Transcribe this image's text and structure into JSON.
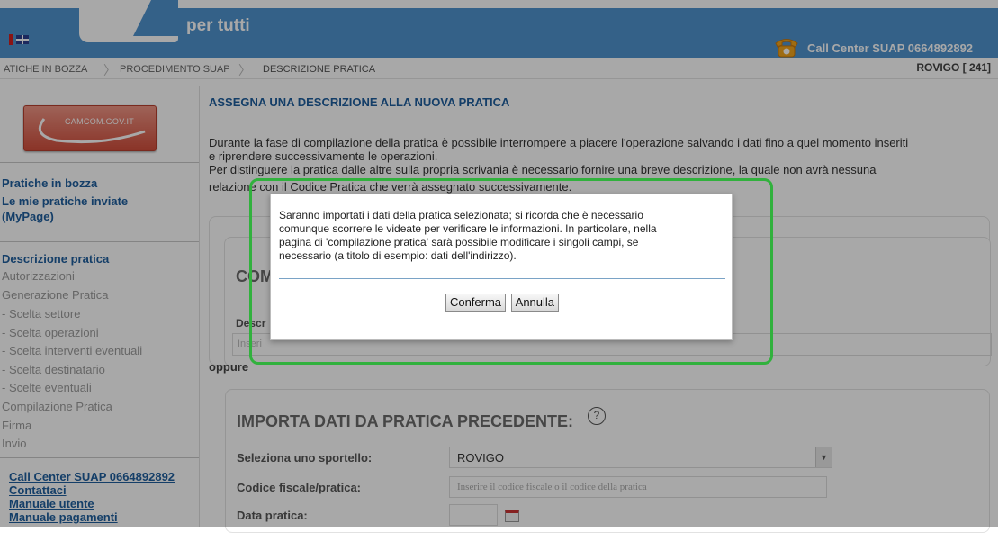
{
  "header": {
    "tagline": "per tutti",
    "call_center": "Call Center SUAP 0664892892",
    "phone_icon": "phone-icon",
    "flag_icon": "uk-flag-icon"
  },
  "breadcrumb": {
    "items": [
      "ATICHE IN BOZZA",
      "PROCEDIMENTO SUAP",
      "DESCRIZIONE PRATICA"
    ],
    "right": "ROVIGO [ 241]"
  },
  "sidebar": {
    "camcom": "CAMCOM.GOV.IT",
    "top_links": [
      "Pratiche in bozza",
      "Le mie pratiche inviate",
      "(MyPage)"
    ],
    "steps": [
      {
        "label": "Descrizione pratica",
        "active": true
      },
      {
        "label": "Autorizzazioni",
        "active": false
      },
      {
        "label": "Generazione Pratica",
        "active": false
      },
      {
        "label": "- Scelta settore",
        "active": false
      },
      {
        "label": "- Scelta operazioni",
        "active": false
      },
      {
        "label": "- Scelta interventi eventuali",
        "active": false
      },
      {
        "label": "- Scelta destinatario",
        "active": false
      },
      {
        "label": "- Scelte eventuali",
        "active": false
      },
      {
        "label": "Compilazione Pratica",
        "active": false
      },
      {
        "label": "Firma",
        "active": false
      },
      {
        "label": "Invio",
        "active": false
      }
    ],
    "bottom_links": [
      "Call Center SUAP 0664892892",
      "Contattaci",
      "Manuale utente",
      "Manuale pagamenti"
    ]
  },
  "main": {
    "title": "ASSEGNA UNA DESCRIZIONE ALLA NUOVA PRATICA",
    "para1_line1": "Durante la fase di compilazione della pratica è possibile interrompere a piacere l'operazione salvando i dati fino a quel momento inseriti",
    "para1_line2": "e riprendere successivamente le operazioni.",
    "para2_line1": "Per distinguere la pratica dalle altre sulla propria scrivania è necessario fornire una breve descrizione, la quale non avrà nessuna",
    "para2_line2": "relazione con il Codice Pratica che verrà assegnato successivamente.",
    "section1_title": "COM",
    "desc_label": "Descr",
    "desc_placeholder": "Inseri",
    "oppure": "oppure",
    "section2_title": "IMPORTA DATI DA PRATICA PRECEDENTE:",
    "help": "?",
    "sportello_label": "Seleziona uno sportello:",
    "sportello_value": "ROVIGO",
    "codice_label": "Codice fiscale/pratica:",
    "codice_placeholder": "Inserire il codice fiscale o il codice della pratica",
    "data_label": "Data pratica:"
  },
  "dialog": {
    "line1": "Saranno importati i dati della pratica selezionata; si ricorda che è necessario",
    "line2": "comunque scorrere le videate per verificare le informazioni. In particolare, nella",
    "line3": "pagina di 'compilazione pratica' sarà possibile modificare i singoli campi, se",
    "line4": "necessario (a titolo di esempio: dati dell'indirizzo).",
    "confirm": "Conferma",
    "cancel": "Annulla"
  },
  "colors": {
    "header": "#4f93cf",
    "link": "#1f5f9e",
    "highlight": "#31b13d"
  }
}
